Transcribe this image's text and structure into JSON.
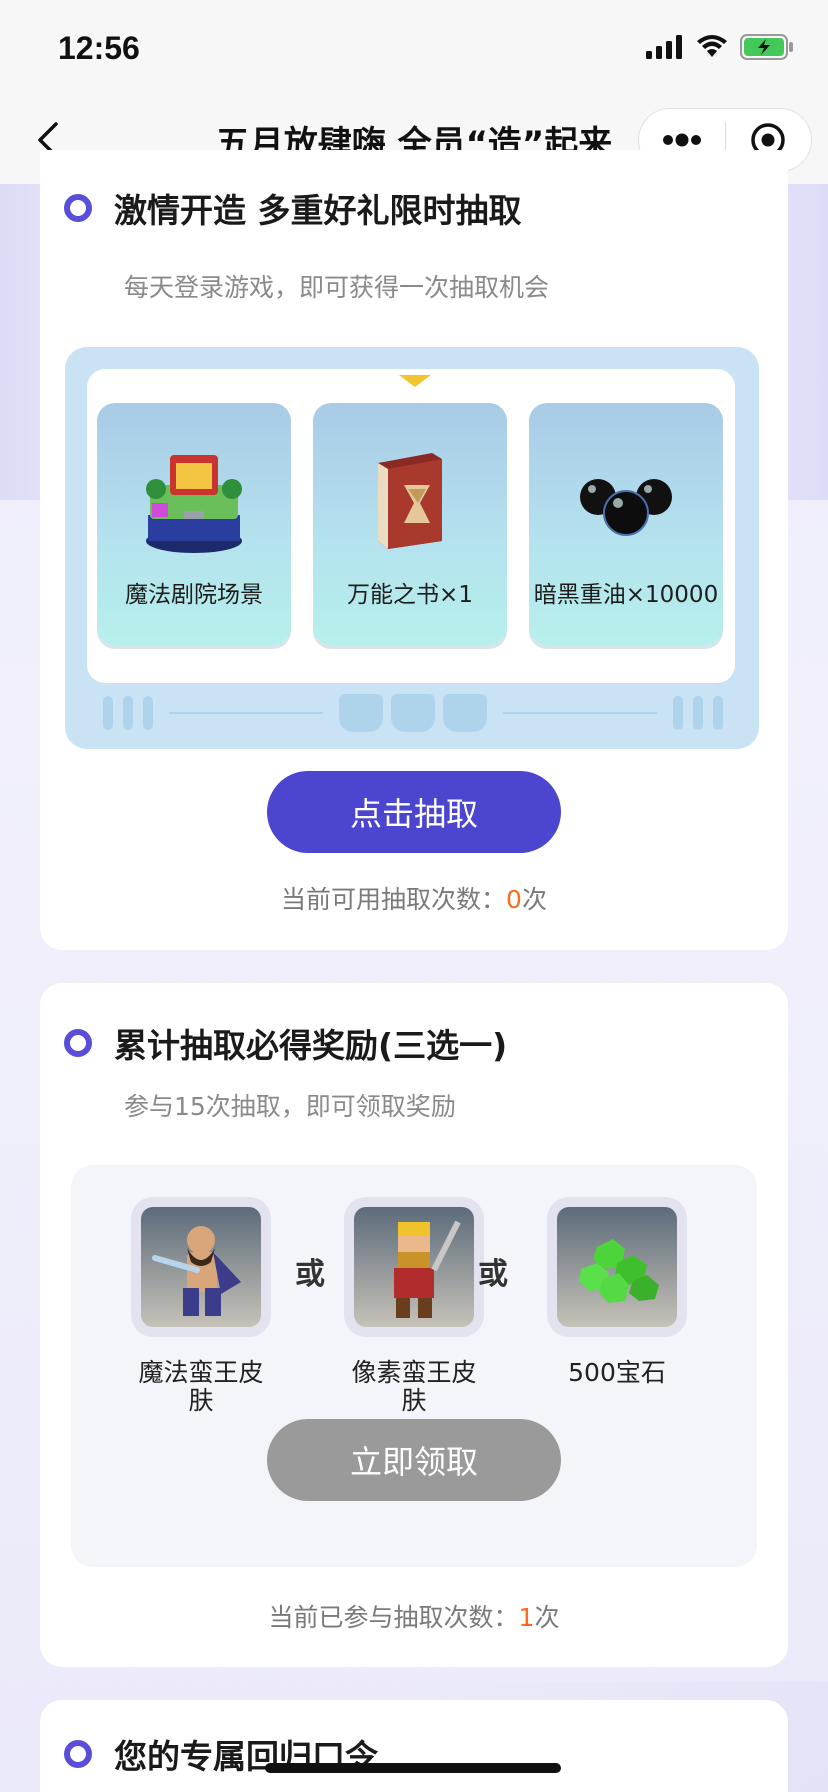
{
  "status_bar": {
    "time": "12:56"
  },
  "nav": {
    "title": "五月放肆嗨 全员“造”起来"
  },
  "section1": {
    "title": "激情开造 多重好礼限时抽取",
    "subtitle": "每天登录游戏，即可获得一次抽取机会",
    "prizes": [
      {
        "label": "魔法剧院场景",
        "icon": "theater-scene-icon"
      },
      {
        "label": "万能之书×1",
        "icon": "book-icon"
      },
      {
        "label": "暗黑重油×10000",
        "icon": "dark-elixir-icon"
      }
    ],
    "draw_button": "点击抽取",
    "count_prefix": "当前可用抽取次数：",
    "count_value": "0",
    "count_suffix": "次"
  },
  "section2": {
    "title": "累计抽取必得奖励(三选一)",
    "subtitle": "参与15次抽取，即可领取奖励",
    "rewards": [
      {
        "label": "魔法蛮王皮肤",
        "icon": "barbarian-king-skin-icon"
      },
      {
        "label": "像素蛮王皮肤",
        "icon": "pixel-king-skin-icon"
      },
      {
        "label": "500宝石",
        "icon": "gems-icon"
      }
    ],
    "or_text": "或",
    "claim_button": "立即领取",
    "count_prefix": "当前已参与抽取次数：",
    "count_value": "1",
    "count_suffix": "次"
  },
  "section3": {
    "title": "您的专属回归口令"
  },
  "colors": {
    "accent": "#4b45cf",
    "highlight": "#ff6a1c",
    "disabled": "#9a9a9a"
  }
}
